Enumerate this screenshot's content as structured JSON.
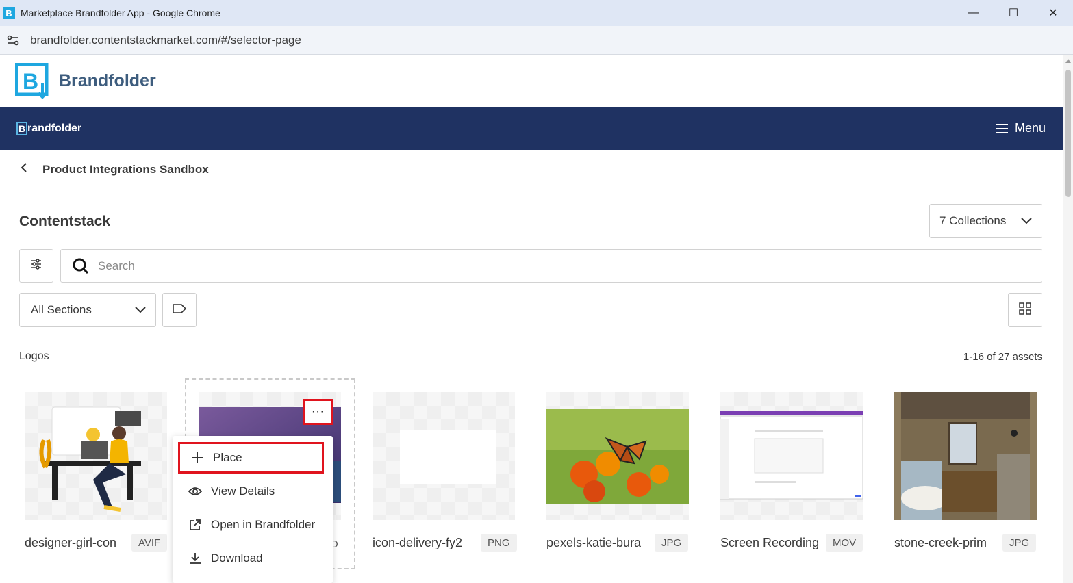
{
  "window": {
    "title": "Marketplace Brandfolder App - Google Chrome",
    "url": "brandfolder.contentstackmarket.com/#/selector-page"
  },
  "app_header": {
    "name": "Brandfolder"
  },
  "navbar": {
    "logo_text": "randfolder",
    "logo_letter": "B",
    "menu_label": "Menu"
  },
  "breadcrumb": {
    "label": "Product Integrations Sandbox"
  },
  "page": {
    "title": "Contentstack",
    "collections_label": "7 Collections",
    "search_placeholder": "Search",
    "sections_label": "All Sections",
    "section_name": "Logos",
    "asset_count": "1-16 of 27 assets"
  },
  "assets": [
    {
      "name": "designer-girl-con",
      "ext": "AVIF"
    },
    {
      "name": "",
      "ext": "O"
    },
    {
      "name": "icon-delivery-fy2",
      "ext": "PNG"
    },
    {
      "name": "pexels-katie-bura",
      "ext": "JPG"
    },
    {
      "name": "Screen Recording",
      "ext": "MOV"
    },
    {
      "name": "stone-creek-prim",
      "ext": "JPG"
    }
  ],
  "context_menu": {
    "more_label": "···",
    "items": [
      {
        "label": "Place",
        "icon": "plus-icon"
      },
      {
        "label": "View Details",
        "icon": "eye-icon"
      },
      {
        "label": "Open in Brandfolder",
        "icon": "external-link-icon"
      },
      {
        "label": "Download",
        "icon": "download-icon"
      }
    ]
  },
  "colors": {
    "navbar": "#1f3262",
    "brand_blue": "#1ea7e0",
    "highlight_red": "#e0141e"
  }
}
